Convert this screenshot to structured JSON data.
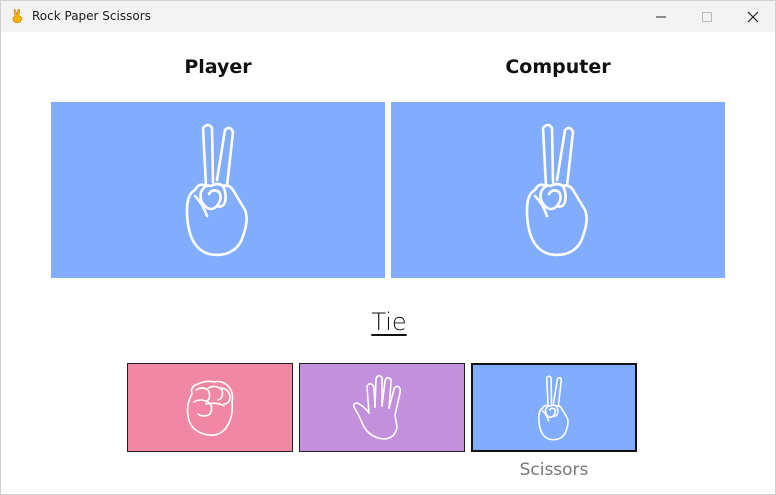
{
  "window": {
    "title": "Rock Paper Scissors"
  },
  "icons": {
    "app": "victory-hand-emoji-icon",
    "minimize": "minimize-icon",
    "maximize": "maximize-icon",
    "close": "close-icon",
    "rock": "fist-icon",
    "paper": "open-hand-icon",
    "scissors": "victory-hand-icon"
  },
  "player": {
    "heading": "Player",
    "choice": "scissors"
  },
  "computer": {
    "heading": "Computer",
    "choice": "scissors"
  },
  "result": "Tie",
  "choices": [
    {
      "id": "rock",
      "color": "#f087a3"
    },
    {
      "id": "paper",
      "color": "#c290dc"
    },
    {
      "id": "scissors",
      "color": "#82adff",
      "label": "Scissors",
      "hovered": true
    }
  ],
  "colors": {
    "panel": "#82adff"
  }
}
